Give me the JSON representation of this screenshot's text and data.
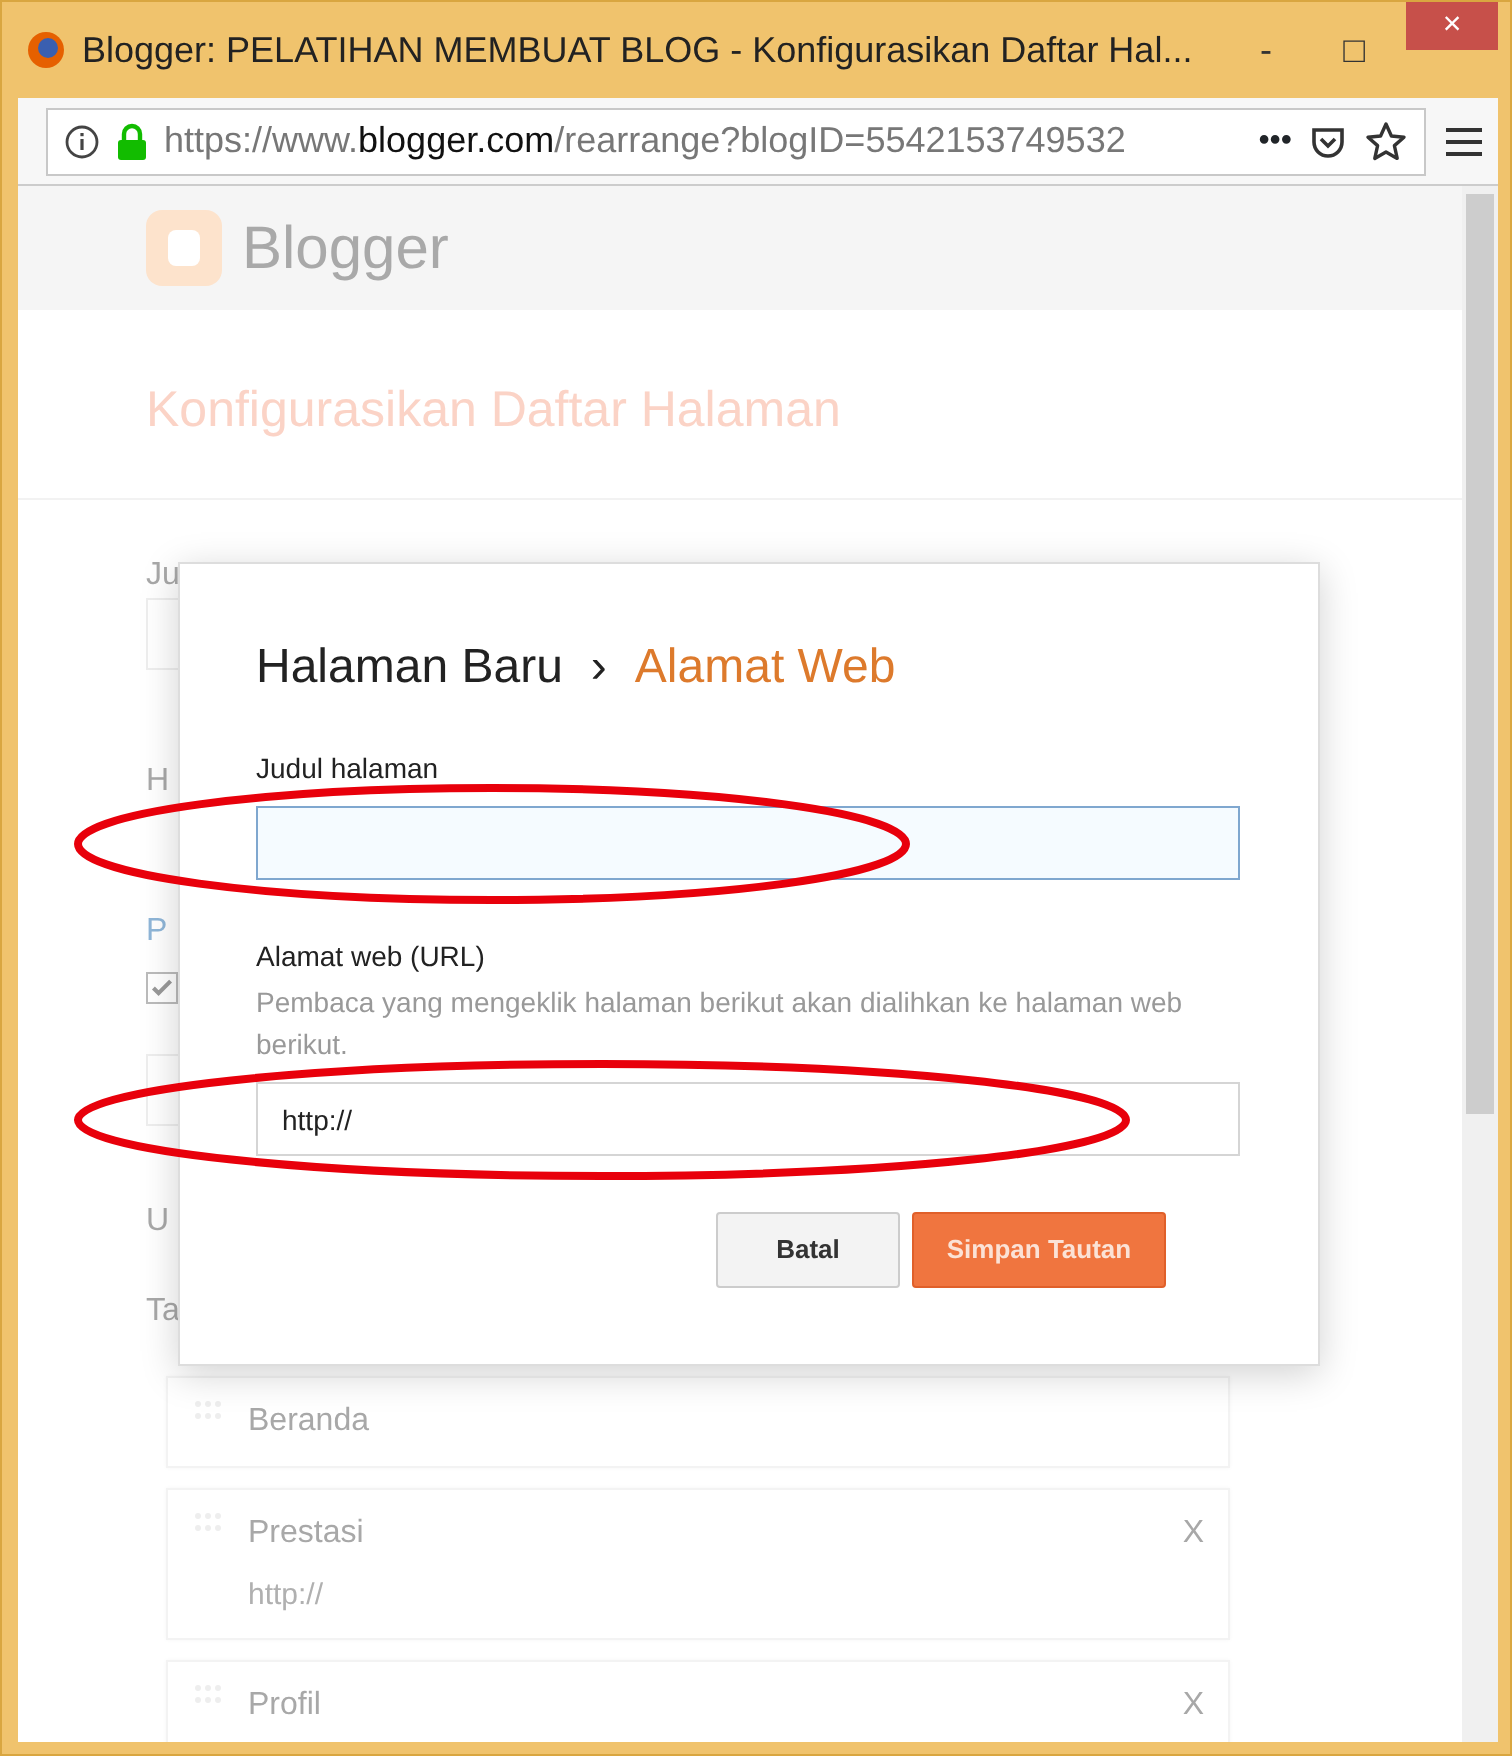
{
  "window": {
    "title": "Blogger: PELATIHAN MEMBUAT BLOG - Konfigurasikan Daftar Hal...",
    "controls": [
      "-",
      "□",
      "×"
    ]
  },
  "address_bar": {
    "url_start": "https://www.",
    "url_domain": "blogger.com",
    "url_end": "/rearrange?blogID=5542153749532",
    "more": "•••"
  },
  "page": {
    "logo": "Blogger",
    "heading": "Konfigurasikan Daftar Halaman",
    "fragments": [
      {
        "kind": "label",
        "text": "Ju"
      },
      {
        "kind": "field"
      },
      {
        "kind": "label",
        "text": "H"
      },
      {
        "kind": "link",
        "text": "P"
      },
      {
        "kind": "checkbox",
        "checked": true
      },
      {
        "kind": "field"
      },
      {
        "kind": "label",
        "text": "U"
      },
      {
        "kind": "label",
        "text": "Ta"
      }
    ],
    "pages": [
      {
        "title": "Beranda"
      },
      {
        "title": "Prestasi",
        "url": "http://",
        "remove": "X"
      },
      {
        "title": "Profil",
        "remove": "X"
      }
    ]
  },
  "dialog": {
    "title": "Halaman Baru",
    "separator": "›",
    "subtitle": "Alamat Web",
    "fields": [
      {
        "label": "Judul halaman",
        "focused": true,
        "circled": true
      },
      {
        "label": "Alamat web (URL)",
        "help": "Pembaca yang mengeklik halaman berikut akan dialihkan ke halaman web berikut.",
        "value": "http://",
        "focused": false,
        "circled": true
      }
    ],
    "buttons": [
      {
        "label": "Batal",
        "kind": "secondary"
      },
      {
        "label": "Simpan Tautan",
        "kind": "primary"
      }
    ]
  }
}
